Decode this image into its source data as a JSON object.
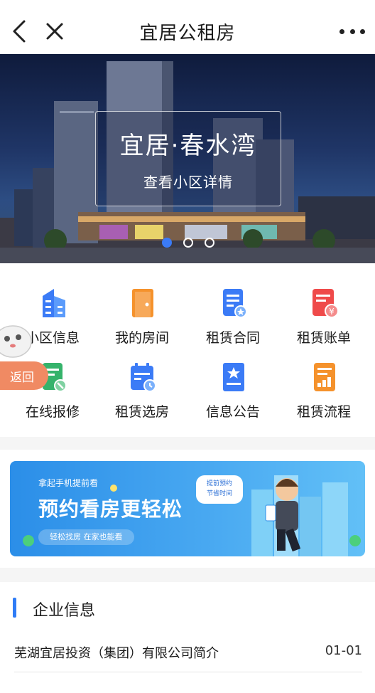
{
  "navbar": {
    "title": "宜居公租房"
  },
  "banner": {
    "title": "宜居·春水湾",
    "subtitle": "查看小区详情",
    "slide_count": 3,
    "active_slide": 1
  },
  "menu": [
    {
      "label": "小区信息",
      "icon": "buildings-icon",
      "color": "#3b7bf6"
    },
    {
      "label": "我的房间",
      "icon": "door-icon",
      "color": "#f5922c"
    },
    {
      "label": "租赁合同",
      "icon": "contract-icon",
      "color": "#3b7bf6"
    },
    {
      "label": "租赁账单",
      "icon": "bill-icon",
      "color": "#ef4a4a"
    },
    {
      "label": "在线报修",
      "icon": "repair-icon",
      "color": "#35b36b"
    },
    {
      "label": "租赁选房",
      "icon": "calendar-icon",
      "color": "#3b7bf6"
    },
    {
      "label": "信息公告",
      "icon": "bookmark-icon",
      "color": "#3b7bf6"
    },
    {
      "label": "租赁流程",
      "icon": "process-icon",
      "color": "#f5922c"
    }
  ],
  "return_button": {
    "label": "返回"
  },
  "ad": {
    "small_text": "拿起手机提前看",
    "main_text": "预约看房更轻松",
    "pill_text": "轻松找房 在家也能看",
    "bubble_line1": "提前预约",
    "bubble_line2": "节省时间"
  },
  "company": {
    "section_title": "企业信息",
    "items": [
      {
        "title": "芜湖宜居投资（集团）有限公司简介",
        "date": "01-01"
      }
    ]
  },
  "colors": {
    "accent": "#2f7cf6",
    "return": "#f08a63"
  }
}
